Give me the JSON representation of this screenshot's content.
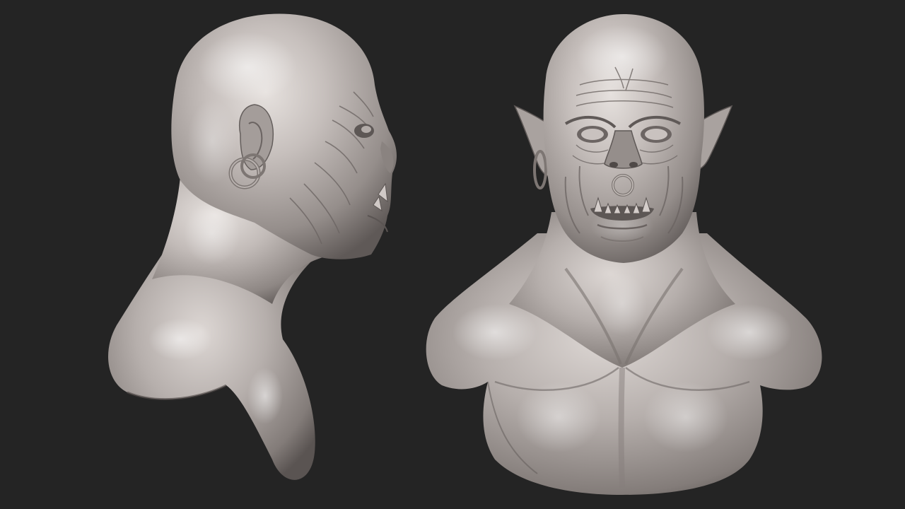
{
  "scene": {
    "background_color": "#242424",
    "material_color": "#b8b1ae",
    "views": [
      {
        "name": "orc-bust-side-view",
        "orientation": "right-profile"
      },
      {
        "name": "orc-bust-front-view",
        "orientation": "front"
      }
    ]
  }
}
